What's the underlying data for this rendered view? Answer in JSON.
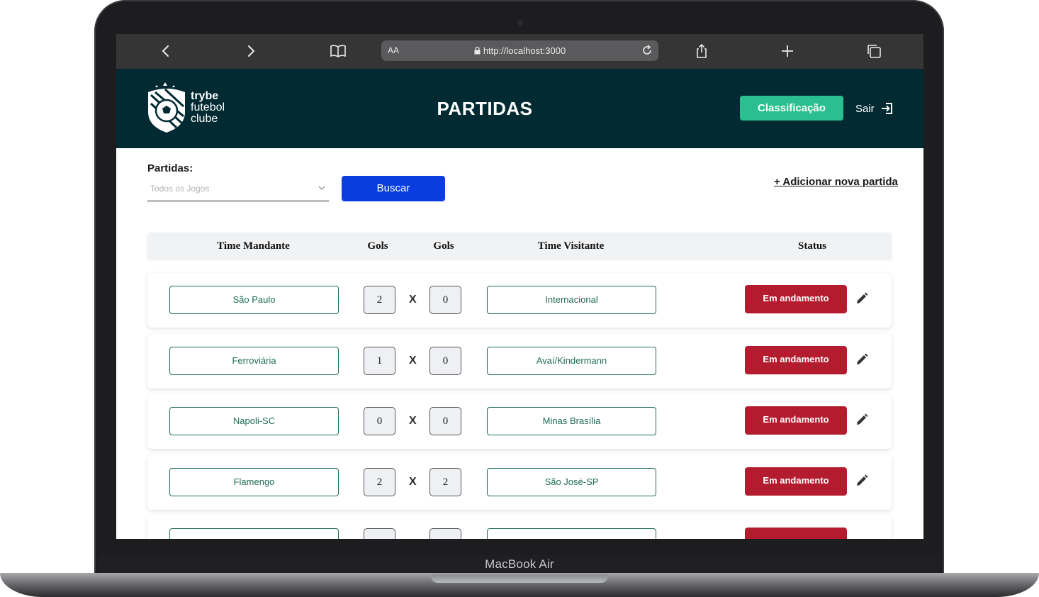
{
  "device": {
    "label": "MacBook Air"
  },
  "browser": {
    "aa_label": "AA",
    "url": "http://localhost:3000"
  },
  "header": {
    "logo_line1": "trybe",
    "logo_line2": "futebol",
    "logo_line3": "clube",
    "title": "PARTIDAS",
    "classification_label": "Classificação",
    "logout_label": "Sair"
  },
  "filter": {
    "label": "Partidas:",
    "select_value": "Todos os Jogos",
    "search_label": "Buscar",
    "add_link": "+ Adicionar nova partida"
  },
  "table": {
    "headers": [
      "Time Mandante",
      "Gols",
      "Gols",
      "Time Visitante",
      "Status"
    ],
    "vs": "X",
    "rows": [
      {
        "home": "São Paulo",
        "home_goals": "2",
        "away_goals": "0",
        "away": "Internacional",
        "status": "Em andamento"
      },
      {
        "home": "Ferroviária",
        "home_goals": "1",
        "away_goals": "0",
        "away": "Avaí/Kindermann",
        "status": "Em andamento"
      },
      {
        "home": "Napoli-SC",
        "home_goals": "0",
        "away_goals": "0",
        "away": "Minas Brasília",
        "status": "Em andamento"
      },
      {
        "home": "Flamengo",
        "home_goals": "2",
        "away_goals": "2",
        "away": "São José-SP",
        "status": "Em andamento"
      }
    ]
  },
  "colors": {
    "header_bg": "#012a32",
    "classification_bg": "#2bbf8f",
    "search_bg": "#0a3ddf",
    "status_bg": "#b31b2e",
    "team_border": "#1f6d58"
  }
}
